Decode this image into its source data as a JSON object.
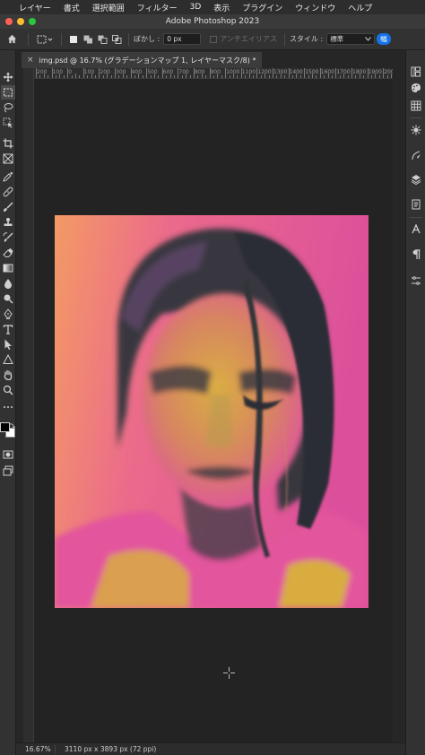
{
  "menubar": {
    "items": [
      "レイヤー",
      "書式",
      "選択範囲",
      "フィルター",
      "3D",
      "表示",
      "プラグイン",
      "ウィンドウ",
      "ヘルプ"
    ]
  },
  "window": {
    "title": "Adobe Photoshop 2023",
    "traffic_colors": [
      "#fe5f57",
      "#febc2e",
      "#28c840"
    ]
  },
  "options": {
    "feather_label": "ぼかし :",
    "feather_value": "0 px",
    "antialias_label": "アンチエイリアス",
    "style_label": "スタイル :",
    "style_value": "標準",
    "width_label": "幅"
  },
  "document": {
    "tab_label": "img.psd @ 16.7% (グラデーションマップ 1, レイヤーマスク/8) *",
    "close_symbol": "×"
  },
  "ruler": {
    "labels": [
      "200",
      "100",
      "0",
      "100",
      "200",
      "300",
      "400",
      "500",
      "600",
      "700",
      "800",
      "900",
      "1000",
      "1100",
      "1200",
      "1300",
      "1400",
      "1500",
      "1600",
      "1700",
      "1800",
      "1900",
      "2000"
    ]
  },
  "status": {
    "zoom": "16.67%",
    "doc_info": "3110 px x 3893 px (72 ppi)"
  },
  "colors": {
    "accent": "#1473e6",
    "portrait_pink": "#e2589f",
    "portrait_orange": "#f59a62",
    "portrait_yellow": "#d8b43a",
    "portrait_dark": "#243235"
  },
  "tools_left": [
    "move-icon",
    "marquee-icon",
    "lasso-icon",
    "object-select-icon",
    "crop-icon",
    "frame-icon",
    "eyedropper-icon",
    "healing-icon",
    "brush-icon",
    "stamp-icon",
    "history-brush-icon",
    "eraser-icon",
    "gradient-icon",
    "blur-icon",
    "dodge-icon",
    "pen-icon",
    "type-icon",
    "path-select-icon",
    "shape-icon",
    "hand-icon",
    "zoom-icon",
    "more-icon"
  ],
  "tools_right": [
    "libraries-icon",
    "color-icon",
    "swatches-icon",
    "adjustments-icon",
    "paths-icon",
    "layers-icon",
    "properties-icon",
    "character-icon",
    "paragraph-icon",
    "glyphs-icon"
  ]
}
